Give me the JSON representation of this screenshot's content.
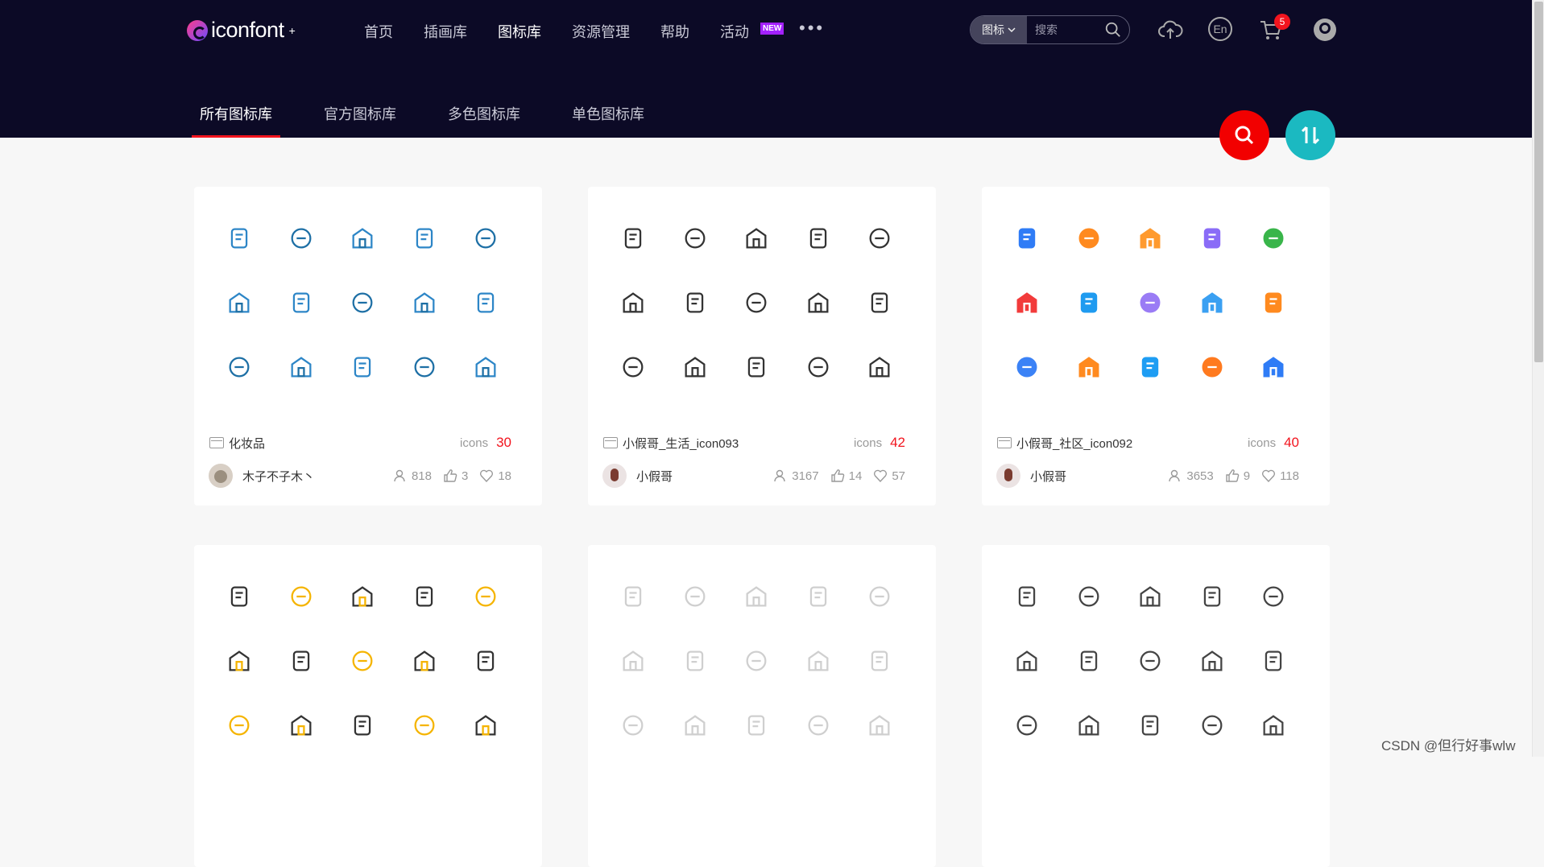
{
  "header": {
    "logo_text": "iconfont",
    "logo_sup": "+",
    "nav": [
      {
        "label": "首页"
      },
      {
        "label": "插画库"
      },
      {
        "label": "图标库"
      },
      {
        "label": "资源管理"
      },
      {
        "label": "帮助"
      },
      {
        "label": "活动",
        "badge": "NEW"
      }
    ],
    "more": "•••",
    "search": {
      "type": "图标",
      "placeholder": "搜索"
    },
    "lang": "En",
    "cart_count": "5"
  },
  "tabs": [
    {
      "label": "所有图标库"
    },
    {
      "label": "官方图标库"
    },
    {
      "label": "多色图标库"
    },
    {
      "label": "单色图标库"
    }
  ],
  "cards": [
    {
      "name": "化妆品",
      "icons_label": "icons",
      "count": "30",
      "user": "木子不子木丶",
      "views": "818",
      "likes": "3",
      "favs": "18",
      "icons": [
        "cosmetic-tube-icon",
        "powder-case-icon",
        "lipstick-icon",
        "bottle-icon",
        "cream-icon",
        "brush-icon",
        "pen-icon",
        "spray-icon",
        "leaf-drop-icon",
        "cabinet-icon",
        "cabinet-tall-icon",
        "compact-icon",
        "lipstick-small-icon",
        "bottle-slim-icon",
        "mirror-icon"
      ]
    },
    {
      "name": "小假哥_生活_icon093",
      "icons_label": "icons",
      "count": "42",
      "user": "小假哥",
      "views": "3167",
      "likes": "14",
      "favs": "57",
      "icons": [
        "bicycle-icon",
        "question-chat-icon",
        "cloud-heart-icon",
        "speaker-icon",
        "trash-icon",
        "dress-icon",
        "paw-icon",
        "balloon-heart-icon",
        "car-icon",
        "headset-person-icon",
        "house-yen-icon",
        "house-key-icon",
        "truck-icon",
        "user-add-icon",
        "store-add-icon"
      ]
    },
    {
      "name": "小假哥_社区_icon092",
      "icons_label": "icons",
      "count": "40",
      "user": "小假哥",
      "views": "3653",
      "likes": "9",
      "favs": "118",
      "icons": [
        "building-icon",
        "scooter-icon",
        "basket-icon",
        "gamepad-icon",
        "melon-icon",
        "flower-icon",
        "cleaning-icon",
        "location-face-icon",
        "document-edit-icon",
        "box-add-icon",
        "user-plus-icon",
        "delivery-truck-icon",
        "home-blue-icon",
        "home-yen-icon",
        "worker-icon"
      ]
    },
    {
      "icons": [
        "basket-icon",
        "truck-icon",
        "speaker-icon",
        "paw-icon",
        "question-chat-icon",
        "sofa-icon",
        "house-icon",
        "trash-icon",
        "house-yen-icon",
        "burger-icon",
        "rings-icon",
        "dress-icon",
        "cleaning-icon",
        "notice-icon",
        "building-icon"
      ]
    },
    {
      "icons": [
        "wallet-icon",
        "question-chat-icon",
        "gift-icon",
        "chevron-down-icon",
        "unlock-icon",
        "cloud-download-icon",
        "download-icon",
        "clipboard-icon",
        "check-icon",
        "yen-circle-icon",
        "eye-icon",
        "heart-pulse-icon",
        "shield-star-icon",
        "document-icon",
        "qrcode-icon"
      ]
    },
    {
      "icons": [
        "gem-icon",
        "pulse-icon",
        "laptop-icon",
        "search-doc-icon",
        "layout-icon",
        "clock-icon",
        "monitor-icon",
        "safe-icon",
        "target-icon",
        "server-icon",
        "slash-icon",
        "chip-icon",
        "volume-icon",
        "ticket-icon",
        "printer-icon"
      ]
    }
  ],
  "colors": {
    "header_bg": "#0c0a26",
    "accent_red": "#f2141e",
    "teal": "#1bb9c1"
  },
  "watermark": "CSDN @但行好事wlw"
}
